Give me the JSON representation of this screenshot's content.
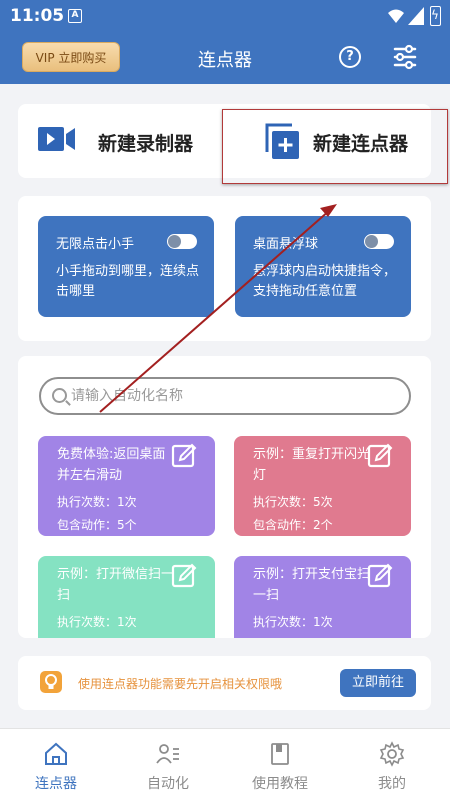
{
  "status_bar": {
    "time": "11:05",
    "notification_icon": "A"
  },
  "app_bar": {
    "vip_label": "VIP 立即购买",
    "title": "连点器",
    "help_icon": "question-circle-icon",
    "settings_icon": "sliders-icon"
  },
  "create": {
    "record_label": "新建录制器",
    "record_icon": "video-camera-icon",
    "clicker_label": "新建连点器",
    "clicker_icon": "add-copy-icon"
  },
  "features": [
    {
      "title": "无限点击小手",
      "desc": "小手拖动到哪里，连续点击哪里",
      "enabled": false
    },
    {
      "title": "桌面悬浮球",
      "desc": "悬浮球内启动快捷指令，支持拖动任意位置",
      "enabled": false
    }
  ],
  "search": {
    "placeholder": "请输入自动化名称",
    "value": ""
  },
  "tasks": [
    {
      "title": "免费体验:返回桌面并左右滑动",
      "count": "执行次数：1次",
      "actions": "包含动作：5个",
      "color": "#a184e6"
    },
    {
      "title": "示例：重复打开闪光灯",
      "count": "执行次数：5次",
      "actions": "包含动作：2个",
      "color": "#e07a8f"
    },
    {
      "title": "示例：打开微信扫一扫",
      "count": "执行次数：1次",
      "actions": "",
      "color": "#85e2c2"
    },
    {
      "title": "示例：打开支付宝扫一扫",
      "count": "执行次数：1次",
      "actions": "",
      "color": "#a184e6"
    }
  ],
  "notice": {
    "text": "使用连点器功能需要先开启相关权限哦",
    "button": "立即前往"
  },
  "nav": [
    {
      "label": "连点器",
      "icon": "home-icon",
      "active": true
    },
    {
      "label": "自动化",
      "icon": "profile-list-icon",
      "active": false
    },
    {
      "label": "使用教程",
      "icon": "book-icon",
      "active": false
    },
    {
      "label": "我的",
      "icon": "gear-icon",
      "active": false
    }
  ],
  "colors": {
    "primary": "#3f74bf",
    "background": "#f2f3f6",
    "annotation": "#b23a3a"
  }
}
